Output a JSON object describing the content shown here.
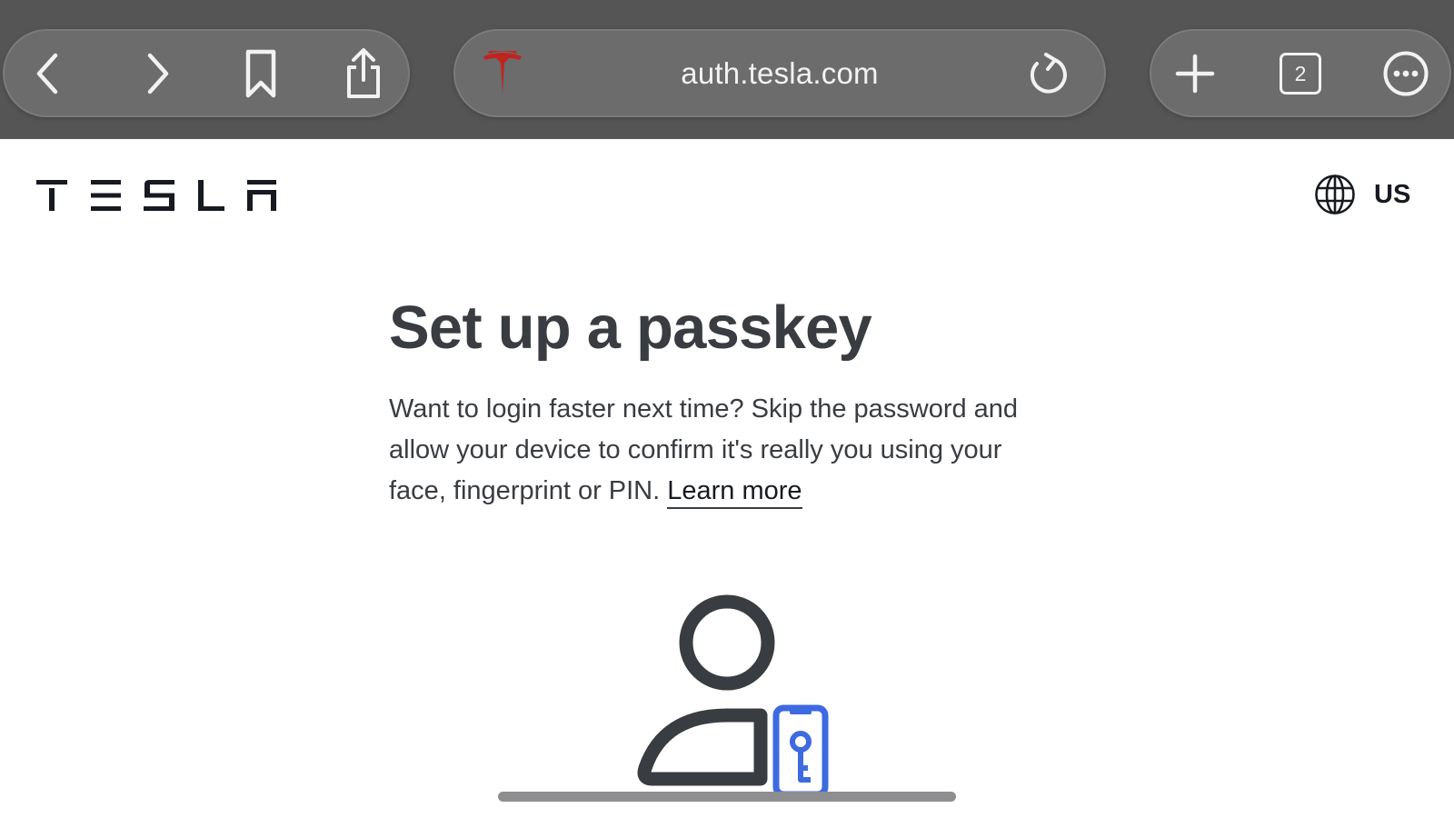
{
  "browser": {
    "url": "auth.tesla.com",
    "tab_count": "2",
    "buttons": {
      "back": "back-chevron-icon",
      "forward": "forward-chevron-icon",
      "bookmarks": "bookmark-icon",
      "share": "share-icon",
      "reload": "reload-icon",
      "new_tab": "plus-icon",
      "tabs": "tabs-icon",
      "more": "more-icon"
    },
    "favicon": "tesla-t-icon",
    "colors": {
      "toolbar": "#555556",
      "pill": "#6c6c6d",
      "favicon": "#c0241f"
    }
  },
  "header": {
    "brand": "TESLA",
    "locale": "US",
    "locale_icon": "globe-icon"
  },
  "main": {
    "title": "Set up a passkey",
    "description": "Want to login faster next time? Skip the password and allow your device to confirm it's really you using your face, fingerprint or PIN. ",
    "learn_more": "Learn more",
    "illustration": "person-with-phone-key-icon",
    "colors": {
      "text": "#393c41",
      "accent": "#3e6ae1"
    }
  }
}
